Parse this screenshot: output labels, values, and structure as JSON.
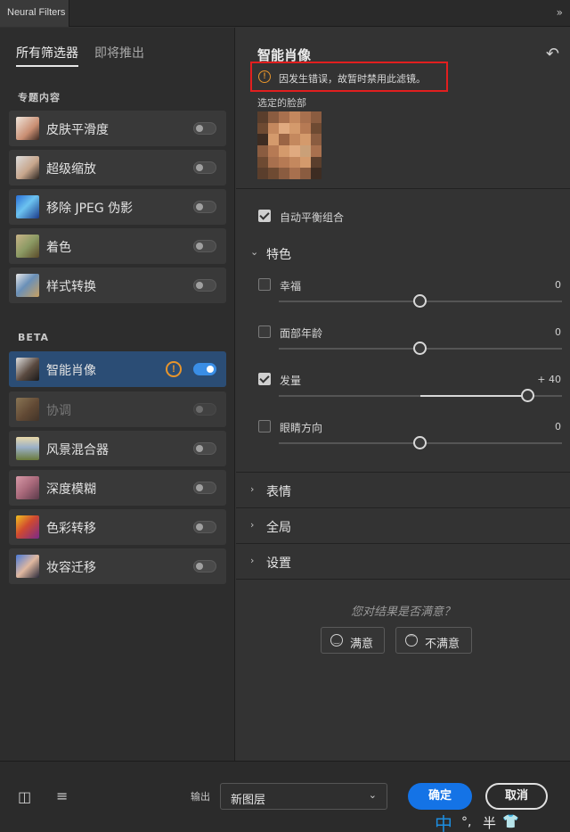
{
  "window": {
    "tab_title": "Neural Filters",
    "collapse_icon": "double-chevron-right-icon"
  },
  "left": {
    "tabs": [
      {
        "label": "所有筛选器"
      },
      {
        "label": "即将推出"
      }
    ],
    "featured_heading": "专题内容",
    "beta_heading": "BETA",
    "featured": [
      {
        "label": "皮肤平滑度",
        "on": false
      },
      {
        "label": "超级缩放",
        "on": false
      },
      {
        "label": "移除 JPEG 伪影",
        "on": false
      },
      {
        "label": "着色",
        "on": false
      },
      {
        "label": "样式转换",
        "on": false
      }
    ],
    "beta": [
      {
        "label": "智能肖像",
        "on": true,
        "selected": true,
        "warning": true
      },
      {
        "label": "协调",
        "on": false,
        "disabled": true
      },
      {
        "label": "风景混合器",
        "on": false
      },
      {
        "label": "深度模糊",
        "on": false
      },
      {
        "label": "色彩转移",
        "on": false
      },
      {
        "label": "妆容迁移",
        "on": false
      }
    ]
  },
  "right": {
    "title": "智能肖像",
    "error_text": "因发生错误，故暂时禁用此滤镜。",
    "error_icon": "!",
    "face_label": "选定的脸部",
    "auto_balance": {
      "label": "自动平衡组合",
      "checked": true
    },
    "features_group": "特色",
    "sliders": [
      {
        "label": "幸福",
        "value": "0",
        "checked": false,
        "position": 0.5
      },
      {
        "label": "面部年龄",
        "value": "0",
        "checked": false,
        "position": 0.5
      },
      {
        "label": "发量",
        "value": "+ 40",
        "checked": true,
        "position": 0.88
      },
      {
        "label": "眼睛方向",
        "value": "0",
        "checked": false,
        "position": 0.5
      }
    ],
    "collapsed_groups": [
      "表情",
      "全局",
      "设置"
    ],
    "feedback_question": "您对结果是否满意？",
    "satisfied": "满意",
    "unsatisfied": "不满意",
    "face_colors": [
      "#6b4a32",
      "#7a5a3e",
      "#8a6446",
      "#6e5038",
      "#5a4230",
      "#4a3a2c"
    ]
  },
  "bottom": {
    "output_label": "输出",
    "output_value": "新图层",
    "ok": "确定",
    "cancel": "取消",
    "ime": {
      "lang": "中",
      "punct": "°,",
      "width": "半",
      "skin": "👕"
    }
  }
}
